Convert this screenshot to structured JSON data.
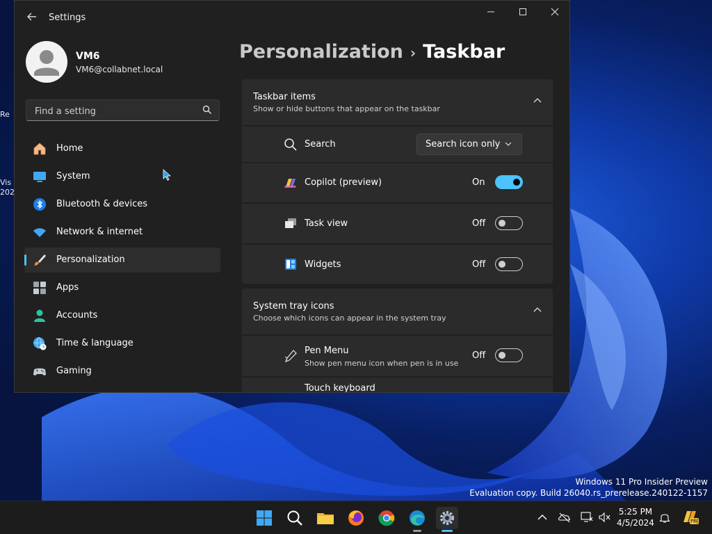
{
  "window": {
    "title": "Settings",
    "controls": {
      "minimize": "—",
      "maximize": "☐",
      "close": "✕"
    }
  },
  "profile": {
    "name": "VM6",
    "email": "VM6@collabnet.local"
  },
  "search": {
    "placeholder": "Find a setting"
  },
  "nav": {
    "items": [
      {
        "label": "Home"
      },
      {
        "label": "System"
      },
      {
        "label": "Bluetooth & devices"
      },
      {
        "label": "Network & internet"
      },
      {
        "label": "Personalization"
      },
      {
        "label": "Apps"
      },
      {
        "label": "Accounts"
      },
      {
        "label": "Time & language"
      },
      {
        "label": "Gaming"
      }
    ],
    "active_index": 4
  },
  "breadcrumb": {
    "parent": "Personalization",
    "separator": "›",
    "current": "Taskbar"
  },
  "taskbar_items": {
    "title": "Taskbar items",
    "subtitle": "Show or hide buttons that appear on the taskbar",
    "search": {
      "label": "Search",
      "value": "Search icon only"
    },
    "copilot": {
      "label": "Copilot (preview)",
      "state": "On"
    },
    "taskview": {
      "label": "Task view",
      "state": "Off"
    },
    "widgets": {
      "label": "Widgets",
      "state": "Off"
    }
  },
  "system_tray": {
    "title": "System tray icons",
    "subtitle": "Choose which icons can appear in the system tray",
    "pen": {
      "label": "Pen Menu",
      "sub": "Show pen menu icon when pen is in use",
      "state": "Off"
    },
    "touch": {
      "label": "Touch keyboard"
    }
  },
  "desktop": {
    "watermark_line1": "Windows 11 Pro Insider Preview",
    "watermark_line2": "Evaluation copy. Build 26040.rs_prerelease.240122-1157",
    "icon_fragments": [
      "Re",
      "Vis",
      "202"
    ]
  },
  "clock": {
    "time": "5:25 PM",
    "date": "4/5/2024"
  },
  "colors": {
    "accent": "#4cc2ff",
    "window_bg": "#202020",
    "card_bg": "#2b2b2b",
    "taskbar_bg": "#1c1c1c"
  }
}
